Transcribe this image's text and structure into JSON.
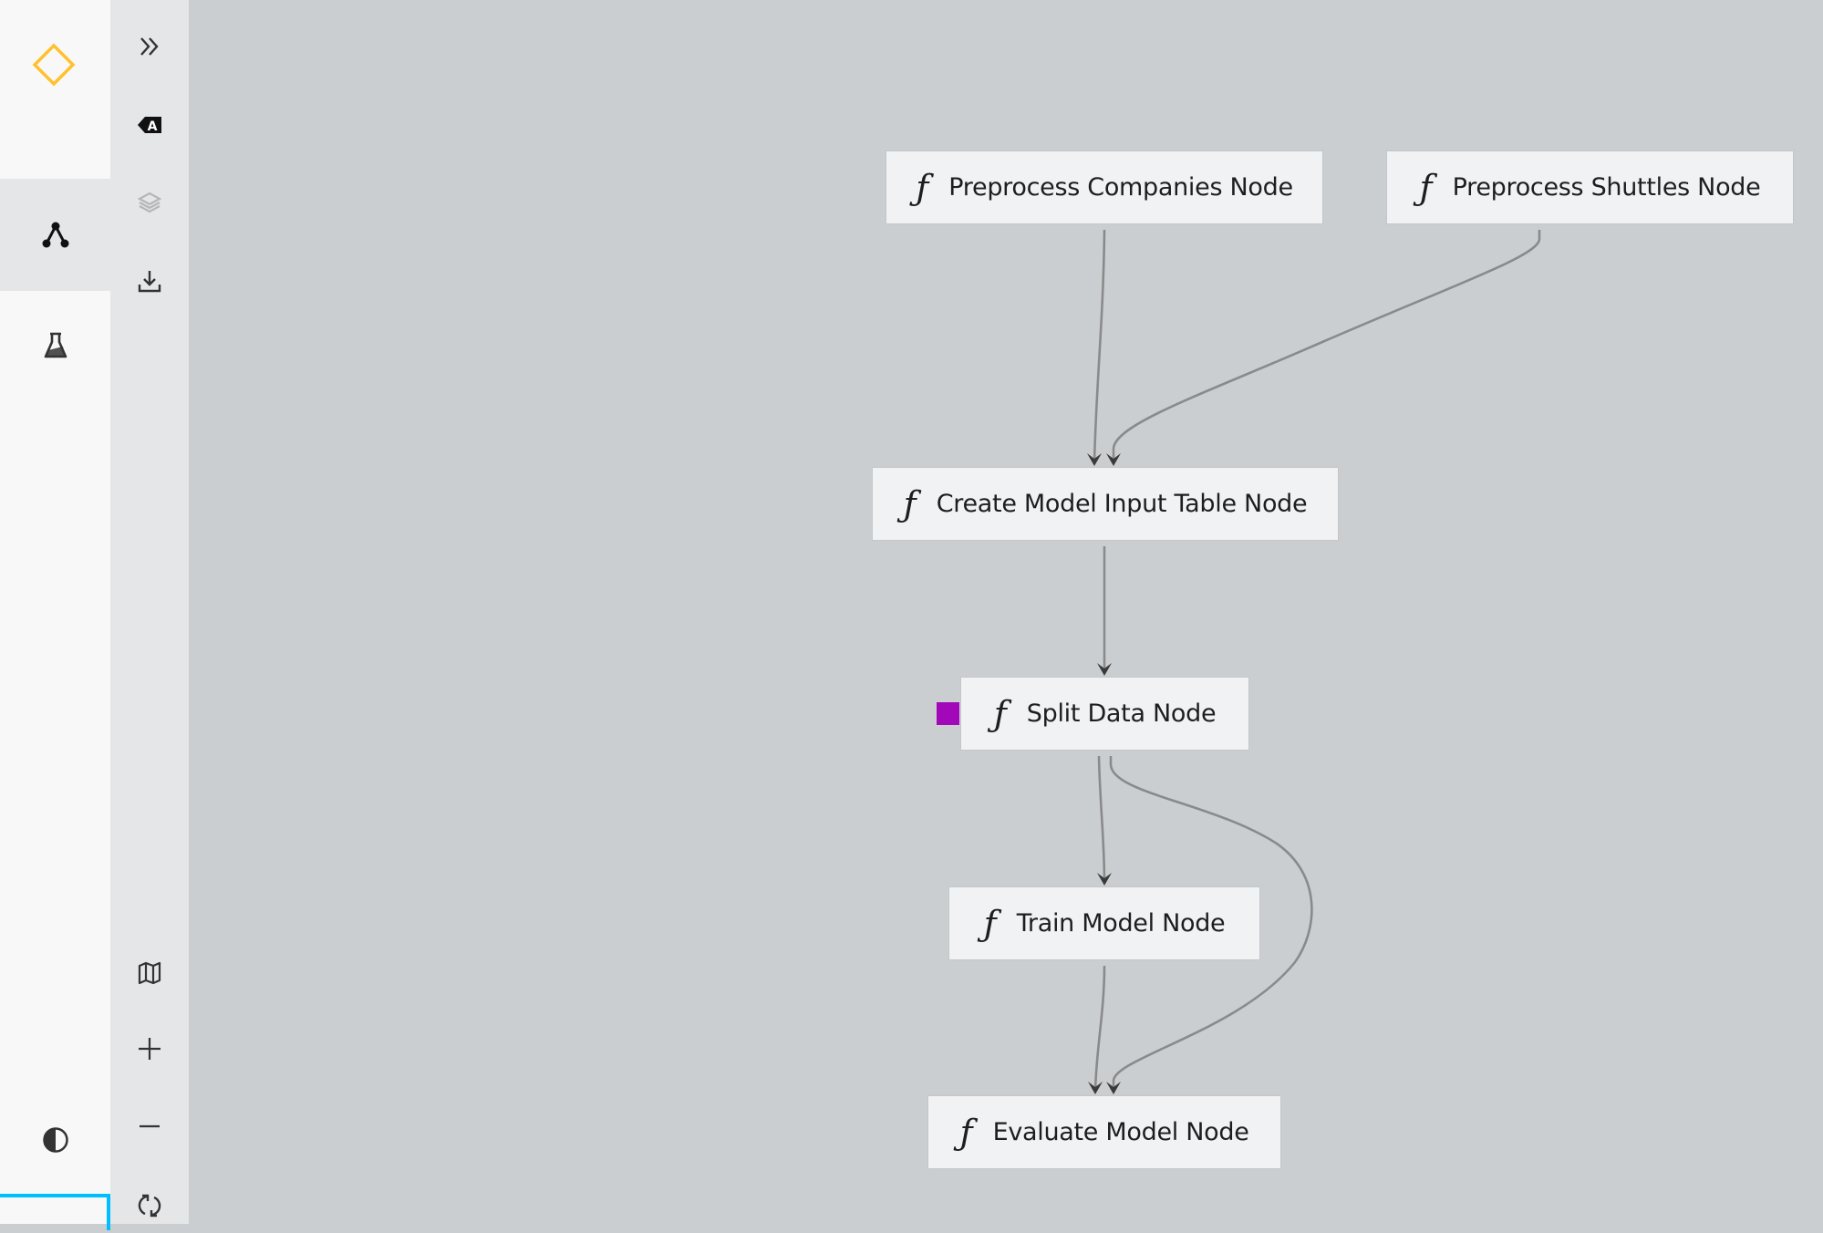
{
  "app": {
    "logo_icon": "diamond-logo-icon",
    "accent_color": "#ffc12e",
    "focus_color": "#00bfff",
    "marker_color": "#a208ba"
  },
  "primary_nav": {
    "items": [
      {
        "id": "flowchart",
        "icon": "pipeline-icon",
        "active": true
      },
      {
        "id": "experiments",
        "icon": "flask-icon",
        "active": false
      }
    ],
    "theme_toggle_icon": "contrast-icon"
  },
  "secondary_nav": {
    "top_tools": [
      {
        "id": "expand",
        "icon": "chevrons-right-icon"
      },
      {
        "id": "labels",
        "icon": "label-icon"
      },
      {
        "id": "layers",
        "icon": "layers-icon",
        "disabled": true
      },
      {
        "id": "export",
        "icon": "download-icon"
      }
    ],
    "bottom_tools": [
      {
        "id": "minimap",
        "icon": "map-icon"
      },
      {
        "id": "zoom-in",
        "icon": "plus-icon"
      },
      {
        "id": "zoom-out",
        "icon": "minus-icon"
      },
      {
        "id": "reset",
        "icon": "reset-icon"
      }
    ]
  },
  "graph": {
    "node_glyph": "ƒ",
    "nodes": [
      {
        "id": "preprocess_companies",
        "label": "Preprocess Companies Node",
        "type": "function"
      },
      {
        "id": "preprocess_shuttles",
        "label": "Preprocess Shuttles Node",
        "type": "function"
      },
      {
        "id": "create_model_input",
        "label": "Create Model Input Table Node",
        "type": "function"
      },
      {
        "id": "split_data",
        "label": "Split Data Node",
        "type": "function",
        "highlighted": true
      },
      {
        "id": "train_model",
        "label": "Train Model Node",
        "type": "function"
      },
      {
        "id": "evaluate_model",
        "label": "Evaluate Model Node",
        "type": "function"
      }
    ],
    "edges": [
      {
        "from": "preprocess_companies",
        "to": "create_model_input"
      },
      {
        "from": "preprocess_shuttles",
        "to": "create_model_input"
      },
      {
        "from": "create_model_input",
        "to": "split_data"
      },
      {
        "from": "split_data",
        "to": "train_model"
      },
      {
        "from": "split_data",
        "to": "evaluate_model"
      },
      {
        "from": "train_model",
        "to": "evaluate_model"
      }
    ]
  }
}
